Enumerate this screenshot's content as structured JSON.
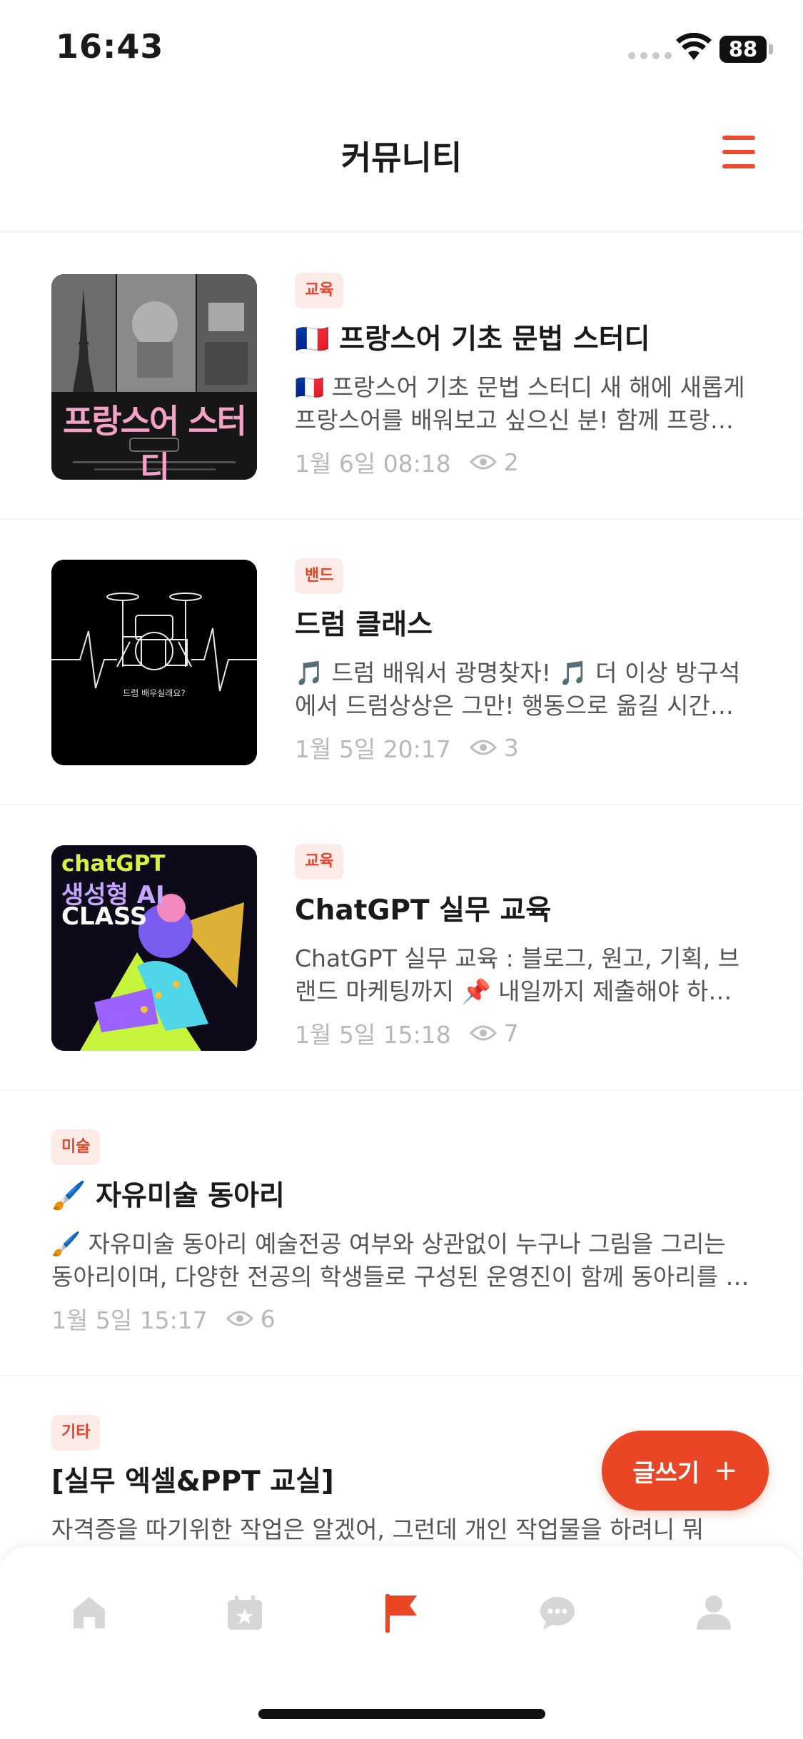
{
  "status_bar": {
    "time": "16:43",
    "battery": "88"
  },
  "header": {
    "title": "커뮤니티"
  },
  "posts": [
    {
      "category": "교육",
      "title": "🇫🇷 프랑스어 기초 문법 스터디",
      "excerpt": "🇫🇷 프랑스어 기초 문법 스터디  새 해에 새롭게 프랑스어를 배워보고 싶으신 분! 함께 프랑스어 공부해요",
      "date": "1월 6일 08:18",
      "views": "2",
      "thumb_text": "프랑스어 스터디"
    },
    {
      "category": "밴드",
      "title": "드럼 클래스",
      "excerpt": "🎵  드럼 배워서 광명찾자! 🎵  더 이상 방구석에서 드럼상상은 그만! 행동으로 옮길 시간입니다",
      "date": "1월 5일 20:17",
      "views": "3",
      "thumb_text": "드럼 배우실래요?"
    },
    {
      "category": "교육",
      "title": "ChatGPT 실무 교육",
      "excerpt": "ChatGPT 실무 교육 : 블로그, 원고, 기획, 브랜드 마케팅까지  📌  내일까지 제출해야 하는 보고서",
      "date": "1월 5일 15:18",
      "views": "7",
      "thumb_line1": "chatGPT",
      "thumb_line2": "생성형 AI",
      "thumb_line3": "CLASS"
    },
    {
      "category": "미술",
      "title": "🖌️ 자유미술 동아리",
      "excerpt": "🖌️ 자유미술 동아리  예술전공 여부와 상관없이 누구나 그림을 그리는 동아리이며, 다양한 전공의 학생들로 구성된 운영진이 함께 동아리를 이끌어갑니다",
      "date": "1월 5일 15:17",
      "views": "6"
    },
    {
      "category": "기타",
      "title": "[실무 엑셀&PPT 교실]",
      "excerpt": "자격증을 따기위한 작업은 알겠어, 그런데 개인 작업물을 하려니 뭐",
      "date": "",
      "views": ""
    }
  ],
  "fab": {
    "label": "글쓰기",
    "icon": "+"
  },
  "tabs": [
    {
      "name": "home",
      "icon": "home-icon"
    },
    {
      "name": "calendar",
      "icon": "calendar-star-icon"
    },
    {
      "name": "community",
      "icon": "flag-icon",
      "active": true
    },
    {
      "name": "chat",
      "icon": "chat-bubble-icon"
    },
    {
      "name": "profile",
      "icon": "person-icon"
    }
  ],
  "colors": {
    "accent": "#ea4524",
    "badge_bg": "#fdebe7",
    "inactive_icon": "#d6d6d6"
  }
}
